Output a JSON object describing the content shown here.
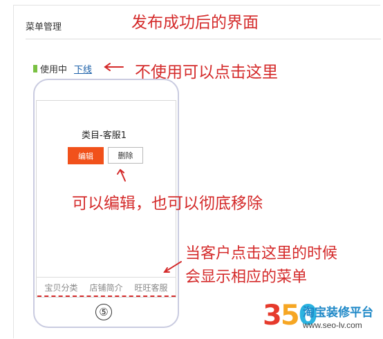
{
  "panel": {
    "title": "菜单管理"
  },
  "status": {
    "label": "使用中",
    "offline_link": "下线",
    "dot_color": "#7ac143"
  },
  "phone": {
    "category_title": "类目-客服1",
    "edit_label": "编辑",
    "delete_label": "删除",
    "menu": [
      "宝贝分类",
      "店铺简介",
      "旺旺客服"
    ],
    "home_glyph": "⑤"
  },
  "annotations": {
    "top": "发布成功后的界面",
    "right": "不使用可以点击这里",
    "middle": "可以编辑，也可以彻底移除",
    "bottom_line1": "当客户点击这里的时候",
    "bottom_line2": "会显示相应的菜单",
    "color": "#d42a2a"
  },
  "logo": {
    "num3": "3",
    "num5": "5",
    "num0": "0",
    "name": "淘宝装修平台",
    "url": "www.seo-lv.com"
  },
  "colors": {
    "accent": "#f1511b",
    "link": "#1a5fa8"
  }
}
